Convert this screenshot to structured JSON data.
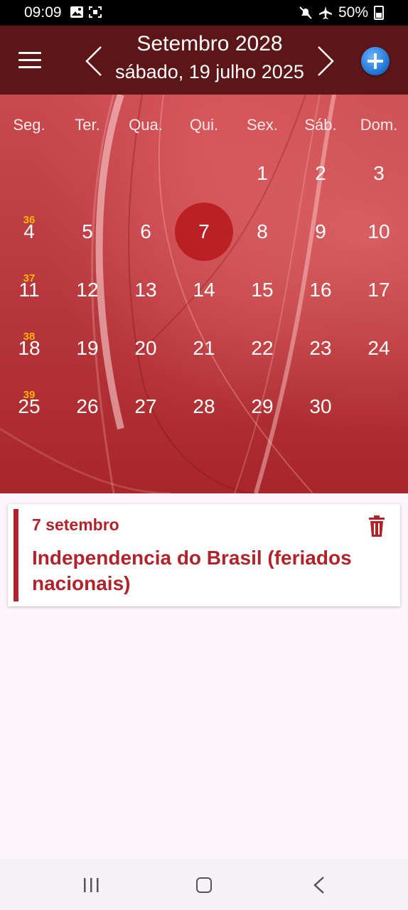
{
  "status": {
    "time": "09:09",
    "battery": "50%",
    "icons": [
      "image-icon",
      "screenshot-icon",
      "mute-icon",
      "airplane-icon",
      "battery-icon"
    ]
  },
  "header": {
    "month_title": "Setembro 2028",
    "today_label": "sábado, 19 julho 2025",
    "icons": [
      "menu-icon",
      "chevron-left-icon",
      "chevron-right-icon",
      "add-icon"
    ]
  },
  "calendar": {
    "weekdays": [
      "Seg.",
      "Ter.",
      "Qua.",
      "Qui.",
      "Sex.",
      "Sáb.",
      "Dom."
    ],
    "weeks": [
      {
        "weeknum": "",
        "days": [
          "",
          "",
          "",
          "",
          "1",
          "2",
          "3"
        ]
      },
      {
        "weeknum": "36",
        "days": [
          "4",
          "5",
          "6",
          "7",
          "8",
          "9",
          "10"
        ]
      },
      {
        "weeknum": "37",
        "days": [
          "11",
          "12",
          "13",
          "14",
          "15",
          "16",
          "17"
        ]
      },
      {
        "weeknum": "38",
        "days": [
          "18",
          "19",
          "20",
          "21",
          "22",
          "23",
          "24"
        ]
      },
      {
        "weeknum": "39",
        "days": [
          "25",
          "26",
          "27",
          "28",
          "29",
          "30",
          ""
        ]
      }
    ],
    "selected_day": "7",
    "colors": {
      "header": "#5c1618",
      "selected": "#b81c1f",
      "weeknum": "#ffb300"
    }
  },
  "event": {
    "date": "7 setembro",
    "title": "Independencia do Brasil (feriados nacionais)",
    "color": "#b1232a",
    "icon": "trash-icon"
  },
  "navbar": {
    "icons": [
      "recents-icon",
      "home-icon",
      "back-icon"
    ]
  }
}
